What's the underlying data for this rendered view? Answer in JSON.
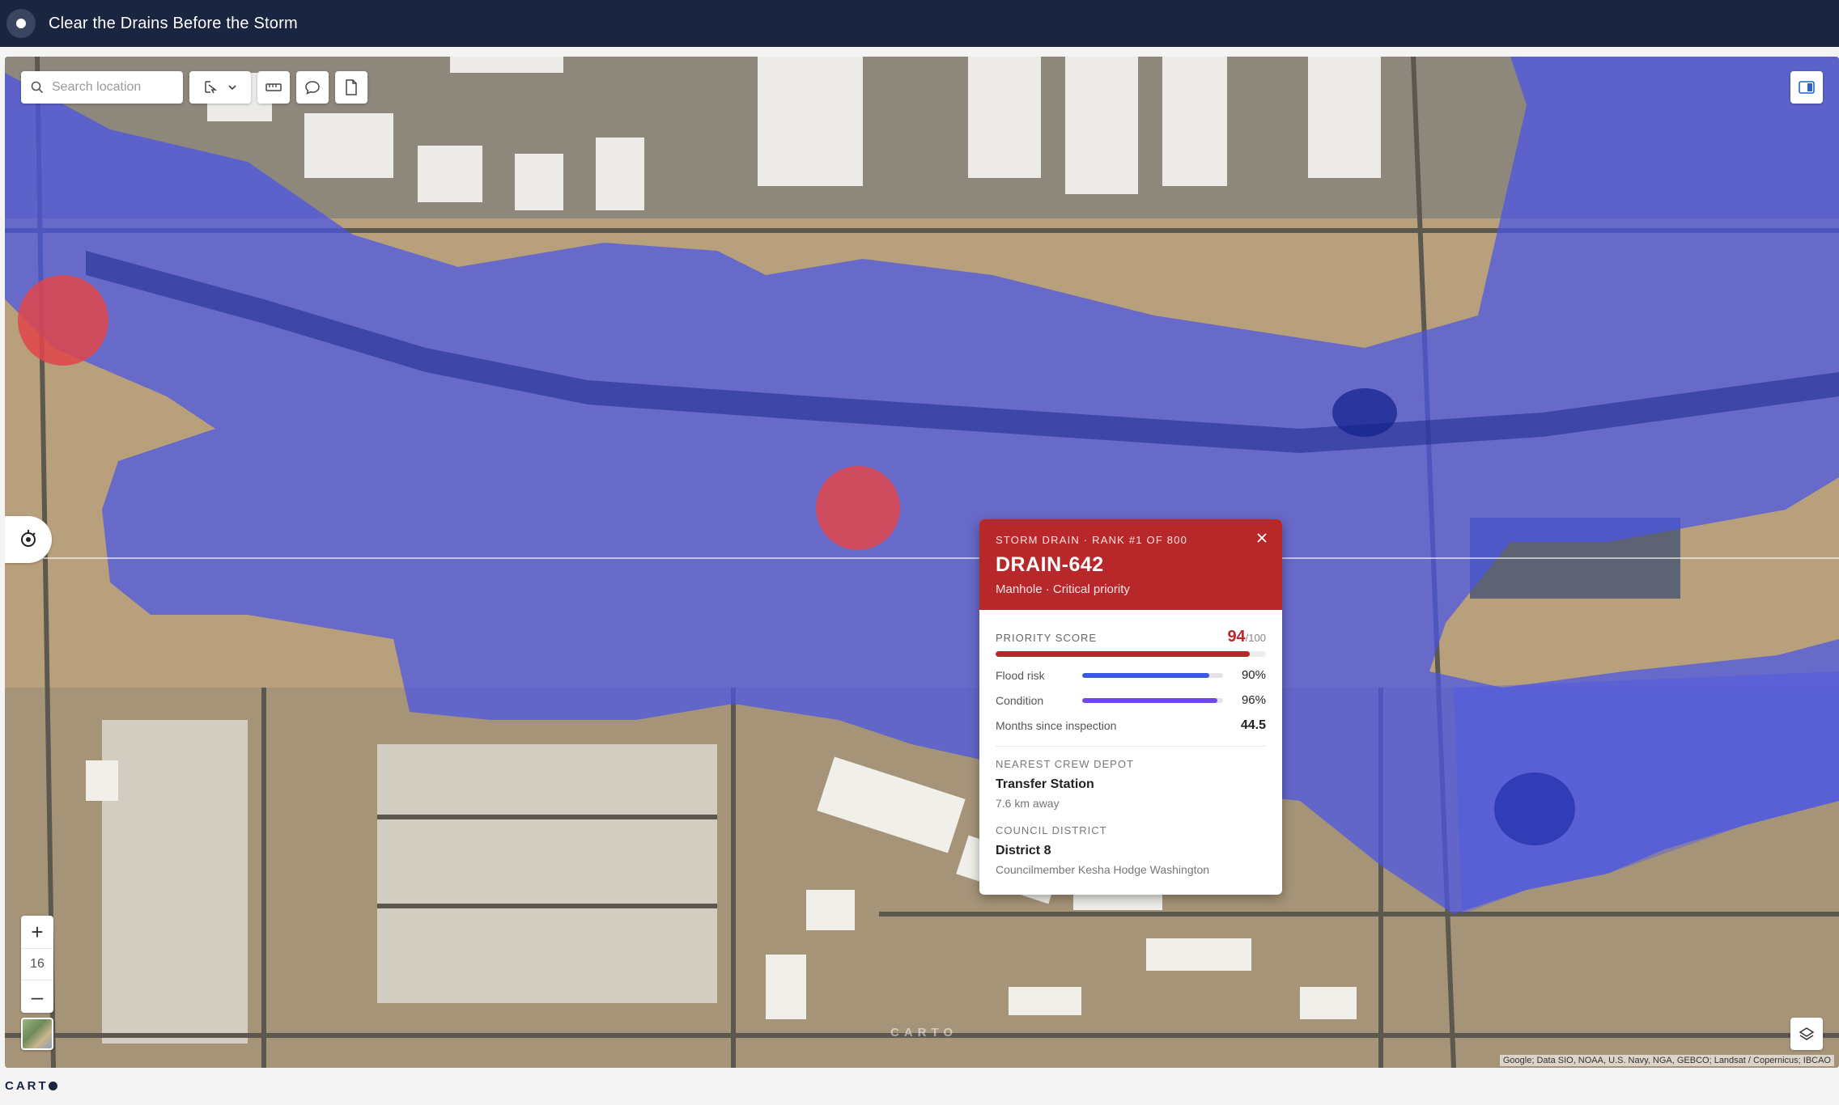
{
  "app": {
    "title": "Clear the Drains Before the Storm"
  },
  "toolbar": {
    "search_placeholder": "Search location",
    "tools": [
      "select-icon",
      "chevron-down-icon",
      "ruler-icon",
      "comment-icon",
      "document-icon"
    ]
  },
  "map": {
    "zoom_level": "16",
    "attribution": "Google; Data SIO, NOAA, U.S. Navy, NGA, GEBCO; Landsat / Copernicus; IBCAO",
    "watermark": "CARTO",
    "colors": {
      "flood_zone": "#4a55e8",
      "drain_marker": "#e0444a",
      "ground": "#b59c78"
    }
  },
  "popup": {
    "kicker": "STORM DRAIN · RANK #1 OF 800",
    "name": "DRAIN-642",
    "subtitle": "Manhole · Critical priority",
    "priority": {
      "label": "PRIORITY SCORE",
      "value": "94",
      "denominator": "/100",
      "fraction": 0.94
    },
    "metrics": [
      {
        "label": "Flood risk",
        "value": "90%",
        "fraction": 0.9,
        "color": "#3b5bdb"
      },
      {
        "label": "Condition",
        "value": "96%",
        "fraction": 0.96,
        "color": "#7048e8"
      }
    ],
    "months_since_inspection": {
      "label": "Months since inspection",
      "value": "44.5"
    },
    "depot": {
      "label": "NEAREST CREW DEPOT",
      "name": "Transfer Station",
      "distance": "7.6 km away"
    },
    "district": {
      "label": "COUNCIL DISTRICT",
      "name": "District 8",
      "member": "Councilmember Kesha Hodge Washington"
    },
    "accent": "#b8282b"
  },
  "footer": {
    "brand": "CART"
  }
}
